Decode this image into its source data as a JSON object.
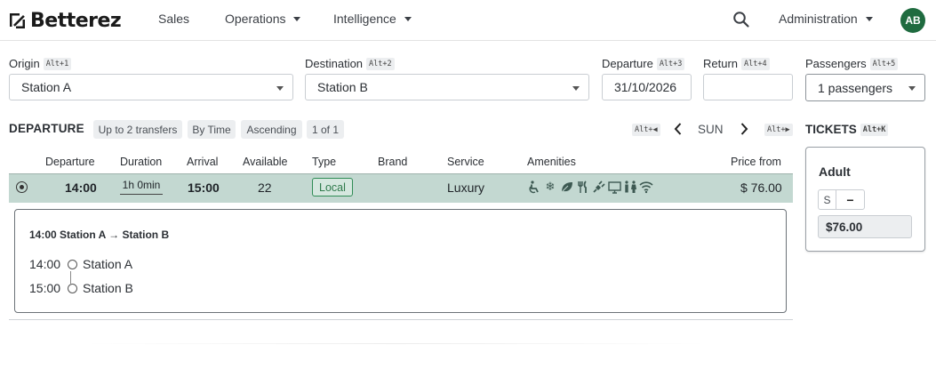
{
  "header": {
    "logo_text": "Betterez",
    "nav": [
      {
        "label": "Sales"
      },
      {
        "label": "Operations"
      },
      {
        "label": "Intelligence"
      }
    ],
    "admin_label": "Administration",
    "avatar_initials": "AB"
  },
  "form": {
    "origin": {
      "label": "Origin",
      "shortcut": "Alt+1",
      "value": "Station A"
    },
    "destination": {
      "label": "Destination",
      "shortcut": "Alt+2",
      "value": "Station B"
    },
    "departure": {
      "label": "Departure",
      "shortcut": "Alt+3",
      "value": "31/10/2026"
    },
    "return": {
      "label": "Return",
      "shortcut": "Alt+4",
      "value": ""
    },
    "passengers": {
      "label": "Passengers",
      "shortcut": "Alt+5",
      "value": "1 passengers"
    }
  },
  "departure_section": {
    "title": "DEPARTURE",
    "chips": [
      "Up to 2 transfers",
      "By Time",
      "Ascending",
      "1 of 1"
    ],
    "pager": {
      "prev_shortcut": "Alt+◀",
      "day": "SUN",
      "next_shortcut": "Alt+▶"
    }
  },
  "table": {
    "headers": [
      "Departure",
      "Duration",
      "Arrival",
      "Available",
      "Type",
      "Brand",
      "Service",
      "Amenities",
      "Price from"
    ],
    "rows": [
      {
        "departure": "14:00",
        "duration": "1h 0min",
        "arrival": "15:00",
        "available": "22",
        "type": "Local",
        "brand": "",
        "service": "Luxury",
        "amenities": [
          "accessible-icon",
          "snowflake-icon",
          "leaf-icon",
          "food-icon",
          "power-plug-icon",
          "monitor-icon",
          "restroom-icon",
          "wifi-icon"
        ],
        "price": "$ 76.00"
      }
    ]
  },
  "detail": {
    "title": "14:00 Station A → Station B",
    "stops": [
      {
        "time": "14:00",
        "station": "Station A"
      },
      {
        "time": "15:00",
        "station": "Station B"
      }
    ]
  },
  "tickets": {
    "title": "TICKETS",
    "shortcut": "Alt+K",
    "name": "Adult",
    "stepper_value": "S",
    "stepper_button": "−",
    "price": "$76.00"
  },
  "colors": {
    "brand_green": "#1f6b3f",
    "selected_row": "#c3d8d1",
    "badge_green": "#2f8c55"
  }
}
